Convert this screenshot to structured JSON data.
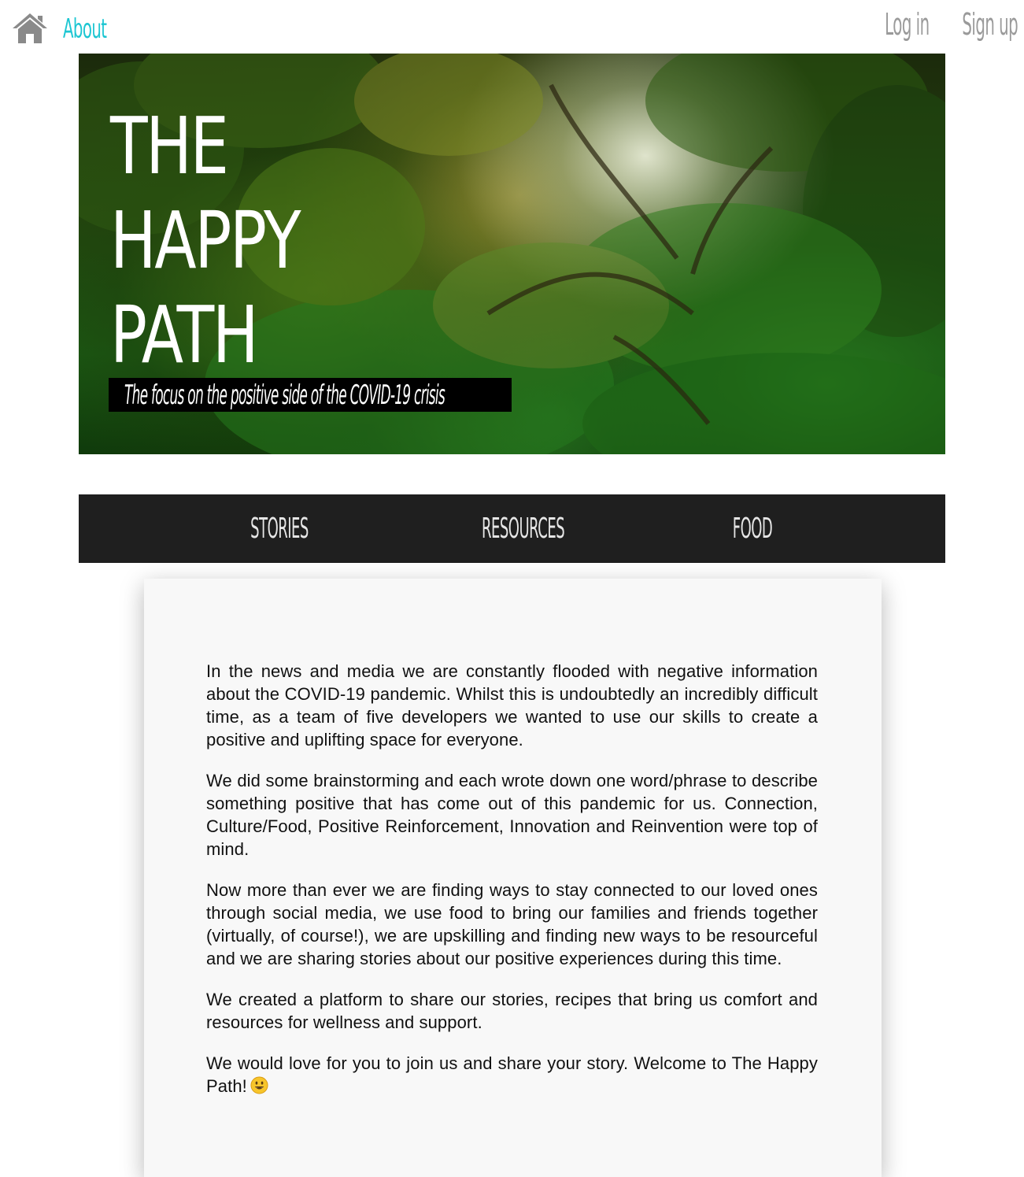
{
  "topbar": {
    "home_icon": "home-icon",
    "about_label": "About",
    "login_label": "Log in",
    "signup_label": "Sign up",
    "about_color": "#1cc6d2",
    "auth_color": "#9a9a9a"
  },
  "hero": {
    "title_line1": "THE",
    "title_line2": "HAPPY",
    "title_line3": "PATH",
    "tagline": "The focus on the positive side of the COVID-19 crisis"
  },
  "nav": {
    "items": [
      {
        "label": "STORIES"
      },
      {
        "label": "RESOURCES"
      },
      {
        "label": "FOOD"
      }
    ],
    "background": "#1f1f1f"
  },
  "about": {
    "paragraphs": [
      "In the news and media we are constantly flooded with negative information about the COVID-19 pandemic. Whilst this is undoubtedly an incredibly difficult time, as a team of five developers we wanted to use our skills to create a positive and uplifting space for everyone.",
      "We did some brainstorming and each wrote down one word/phrase to describe something positive that has come out of this pandemic for us. Connection, Culture/Food, Positive Reinforcement, Innovation and Reinvention were top of mind.",
      "Now more than ever we are finding ways to stay connected to our loved ones through social media, we use food to bring our families and friends together (virtually, of course!), we are upskilling and finding new ways to be resourceful and we are sharing stories about our positive experiences during this time.",
      "We created a platform to share our stories, recipes that bring us comfort and resources for wellness and support.",
      "We would love for you to join us and share your story. Welcome to The Happy Path!"
    ],
    "closing_emoji": "smiley-face-icon"
  }
}
